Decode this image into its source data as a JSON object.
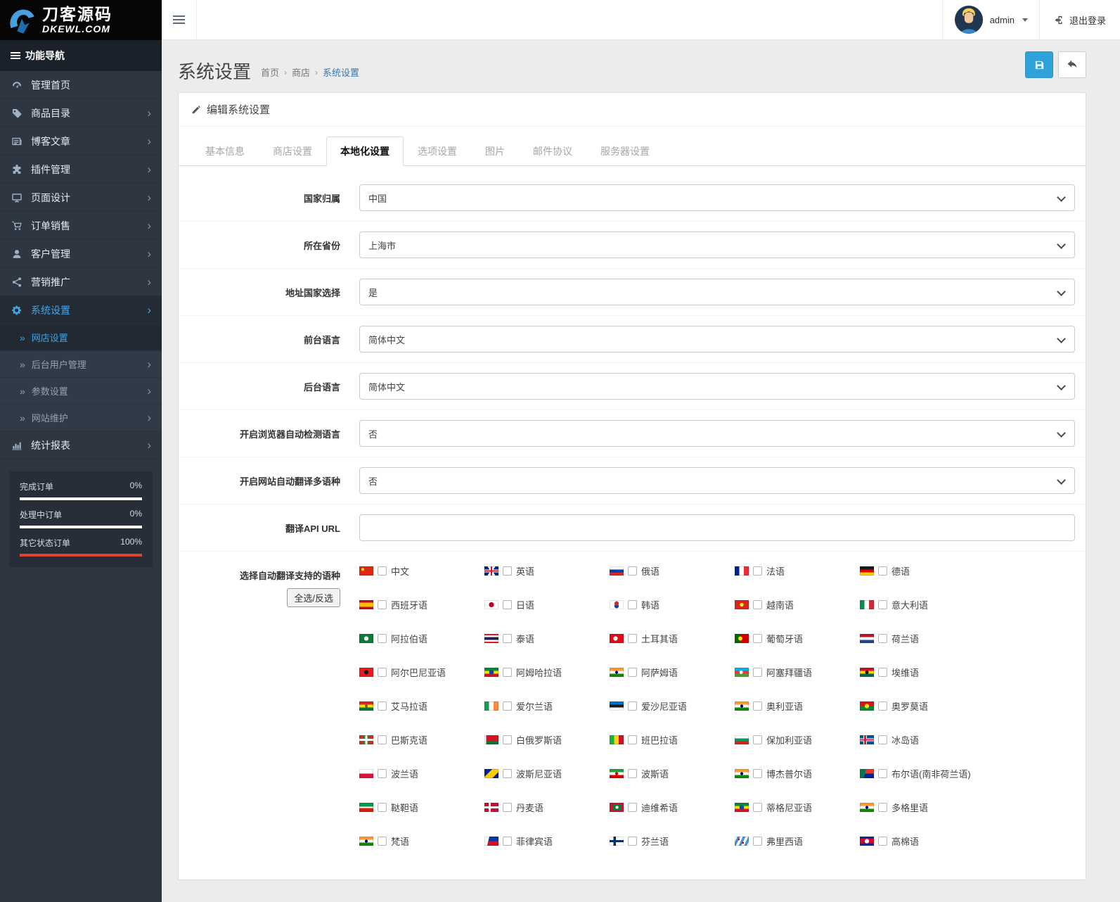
{
  "colors": {
    "accent": "#337ab7",
    "save_button": "#2fa3d9",
    "danger": "#e0452f",
    "sidebar_bg": "#2e3642"
  },
  "brand": {
    "title": "刀客源码",
    "subtitle": "DKEWL.COM"
  },
  "topbar": {
    "username": "admin",
    "logout_label": "退出登录"
  },
  "sidebar": {
    "nav_header": "功能导航",
    "items": [
      {
        "key": "dashboard",
        "icon": "dashboard-icon",
        "label": "管理首页",
        "arrow": false
      },
      {
        "key": "catalog",
        "icon": "tags-icon",
        "label": "商品目录",
        "arrow": true
      },
      {
        "key": "blog",
        "icon": "newspaper-icon",
        "label": "博客文章",
        "arrow": true
      },
      {
        "key": "plugins",
        "icon": "puzzle-icon",
        "label": "插件管理",
        "arrow": true
      },
      {
        "key": "page-design",
        "icon": "desktop-icon",
        "label": "页面设计",
        "arrow": true
      },
      {
        "key": "orders",
        "icon": "cart-icon",
        "label": "订单销售",
        "arrow": true
      },
      {
        "key": "customers",
        "icon": "user-icon",
        "label": "客户管理",
        "arrow": true
      },
      {
        "key": "marketing",
        "icon": "share-icon",
        "label": "营销推广",
        "arrow": true
      },
      {
        "key": "system-settings",
        "icon": "gear-icon",
        "label": "系统设置",
        "arrow": true,
        "active": true,
        "children": [
          {
            "key": "store-settings",
            "label": "网店设置",
            "active": true,
            "arrow": false
          },
          {
            "key": "admin-users",
            "label": "后台用户管理",
            "arrow": true
          },
          {
            "key": "parameters",
            "label": "参数设置",
            "arrow": true
          },
          {
            "key": "maintenance",
            "label": "网站维护",
            "arrow": true
          }
        ]
      },
      {
        "key": "reports",
        "icon": "chart-icon",
        "label": "统计报表",
        "arrow": true
      }
    ],
    "order_stats": [
      {
        "label": "完成订单",
        "value": "0%",
        "pct": 0
      },
      {
        "label": "处理中订单",
        "value": "0%",
        "pct": 0
      },
      {
        "label": "其它状态订单",
        "value": "100%",
        "pct": 100
      }
    ]
  },
  "page": {
    "title": "系统设置",
    "breadcrumb": [
      {
        "label": "首页",
        "active": false
      },
      {
        "label": "商店",
        "active": false
      },
      {
        "label": "系统设置",
        "active": true
      }
    ]
  },
  "panel": {
    "heading": "编辑系统设置",
    "tabs": [
      {
        "key": "basic",
        "label": "基本信息",
        "active": false
      },
      {
        "key": "store",
        "label": "商店设置",
        "active": false
      },
      {
        "key": "localization",
        "label": "本地化设置",
        "active": true
      },
      {
        "key": "options",
        "label": "选项设置",
        "active": false
      },
      {
        "key": "image",
        "label": "图片",
        "active": false
      },
      {
        "key": "mail",
        "label": "邮件协议",
        "active": false
      },
      {
        "key": "server",
        "label": "服务器设置",
        "active": false
      }
    ],
    "fields": [
      {
        "key": "country",
        "label": "国家归属",
        "type": "select",
        "value": "中国"
      },
      {
        "key": "province",
        "label": "所在省份",
        "type": "select",
        "value": "上海市"
      },
      {
        "key": "address-country",
        "label": "地址国家选择",
        "type": "select",
        "value": "是"
      },
      {
        "key": "frontend-language",
        "label": "前台语言",
        "type": "select",
        "value": "简体中文"
      },
      {
        "key": "backend-language",
        "label": "后台语言",
        "type": "select",
        "value": "简体中文"
      },
      {
        "key": "browser-detect-language",
        "label": "开启浏览器自动检测语言",
        "type": "select",
        "value": "否"
      },
      {
        "key": "auto-translate",
        "label": "开启网站自动翻译多语种",
        "type": "select",
        "value": "否"
      },
      {
        "key": "translate-api-url",
        "label": "翻译API URL",
        "type": "text",
        "value": ""
      }
    ],
    "languages_label": "选择自动翻译支持的语种",
    "select_all_label": "全选/反选",
    "languages": [
      {
        "label": "中文",
        "flag": "cn"
      },
      {
        "label": "英语",
        "flag": "gb"
      },
      {
        "label": "俄语",
        "flag": "ru"
      },
      {
        "label": "法语",
        "flag": "fr"
      },
      {
        "label": "德语",
        "flag": "de"
      },
      {
        "label": "西班牙语",
        "flag": "es"
      },
      {
        "label": "日语",
        "flag": "jp"
      },
      {
        "label": "韩语",
        "flag": "kr"
      },
      {
        "label": "越南语",
        "flag": "vn"
      },
      {
        "label": "意大利语",
        "flag": "it"
      },
      {
        "label": "阿拉伯语",
        "flag": "arab"
      },
      {
        "label": "泰语",
        "flag": "th"
      },
      {
        "label": "土耳其语",
        "flag": "tr"
      },
      {
        "label": "葡萄牙语",
        "flag": "pt"
      },
      {
        "label": "荷兰语",
        "flag": "nl"
      },
      {
        "label": "阿尔巴尼亚语",
        "flag": "al"
      },
      {
        "label": "阿姆哈拉语",
        "flag": "et"
      },
      {
        "label": "阿萨姆语",
        "flag": "in"
      },
      {
        "label": "阿塞拜疆语",
        "flag": "az"
      },
      {
        "label": "埃维语",
        "flag": "gh"
      },
      {
        "label": "艾马拉语",
        "flag": "bo"
      },
      {
        "label": "爱尔兰语",
        "flag": "ie"
      },
      {
        "label": "爱沙尼亚语",
        "flag": "ee"
      },
      {
        "label": "奥利亚语",
        "flag": "in"
      },
      {
        "label": "奥罗莫语",
        "flag": "om"
      },
      {
        "label": "巴斯克语",
        "flag": "eu"
      },
      {
        "label": "白俄罗斯语",
        "flag": "by"
      },
      {
        "label": "班巴拉语",
        "flag": "ml"
      },
      {
        "label": "保加利亚语",
        "flag": "bg"
      },
      {
        "label": "冰岛语",
        "flag": "is"
      },
      {
        "label": "波兰语",
        "flag": "pl"
      },
      {
        "label": "波斯尼亚语",
        "flag": "ba"
      },
      {
        "label": "波斯语",
        "flag": "ir"
      },
      {
        "label": "博杰普尔语",
        "flag": "in"
      },
      {
        "label": "布尔语(南非荷兰语)",
        "flag": "za"
      },
      {
        "label": "鞑靼语",
        "flag": "tt"
      },
      {
        "label": "丹麦语",
        "flag": "dk"
      },
      {
        "label": "迪维希语",
        "flag": "mv"
      },
      {
        "label": "蒂格尼亚语",
        "flag": "et"
      },
      {
        "label": "多格里语",
        "flag": "in"
      },
      {
        "label": "梵语",
        "flag": "in"
      },
      {
        "label": "菲律宾语",
        "flag": "ph"
      },
      {
        "label": "芬兰语",
        "flag": "fi"
      },
      {
        "label": "弗里西语",
        "flag": "fy"
      },
      {
        "label": "高棉语",
        "flag": "kh"
      }
    ]
  }
}
